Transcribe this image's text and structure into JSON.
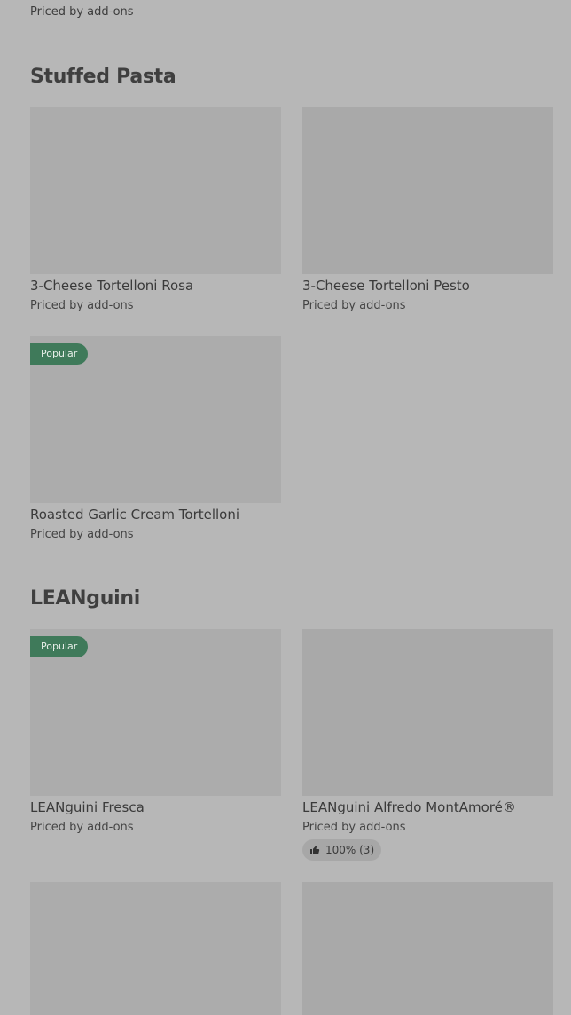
{
  "top_item": {
    "price": "Priced by add-ons"
  },
  "sections": [
    {
      "title": "Stuffed Pasta",
      "items": [
        {
          "name": "3-Cheese Tortelloni Rosa",
          "price": "Priced by add-ons"
        },
        {
          "name": "3-Cheese Tortelloni Pesto",
          "price": "Priced by add-ons"
        },
        {
          "name": "Roasted Garlic Cream Tortelloni",
          "price": "Priced by add-ons",
          "badge": "Popular"
        }
      ]
    },
    {
      "title": "LEANguini",
      "items": [
        {
          "name": "LEANguini Fresca",
          "price": "Priced by add-ons",
          "badge": "Popular"
        },
        {
          "name": "LEANguini Alfredo MontAmoré®",
          "price": "Priced by add-ons",
          "rating": "100% (3)"
        }
      ]
    }
  ],
  "colors": {
    "badge_bg": "#3f7a5a",
    "page_bg": "#b7b7b7",
    "image_placeholder": "#acacac"
  },
  "icons": {
    "rating": "thumbs-up-icon"
  }
}
